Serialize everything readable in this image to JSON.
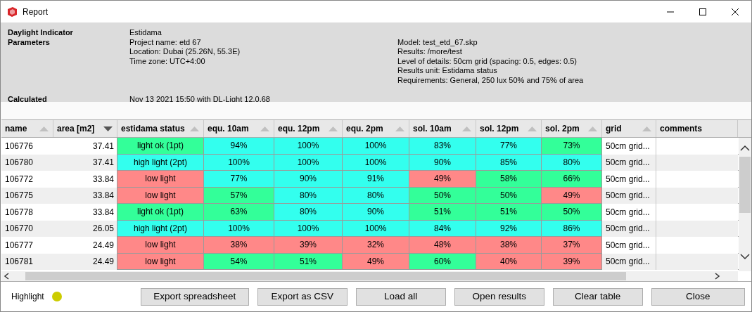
{
  "window": {
    "title": "Report"
  },
  "info": {
    "indicator": {
      "label": "Daylight Indicator",
      "value": "Estidama"
    },
    "parameters": {
      "label": "Parameters",
      "left": [
        "Project name: etd 67",
        "Location: Dubai (25.26N, 55.3E)",
        "Time zone: UTC+4:00"
      ],
      "right": [
        "Model: test_etd_67.skp",
        "Results: /more/test",
        "Level of details: 50cm grid (spacing: 0.5, edges: 0.5)",
        "Results unit: Estidama status",
        "Requirements: General, 250 lux 50% and 75% of area"
      ]
    },
    "calculated": {
      "label": "Calculated",
      "value": "Nov 13 2021 15:50 with DL-Light 12.0.68"
    }
  },
  "table": {
    "columns": [
      {
        "label": "name",
        "sortable": true,
        "descending": false
      },
      {
        "label": "area [m2]",
        "sortable": true,
        "descending": true
      },
      {
        "label": "estidama status",
        "sortable": true,
        "descending": false
      },
      {
        "label": "equ. 10am",
        "sortable": true,
        "descending": false
      },
      {
        "label": "equ. 12pm",
        "sortable": true,
        "descending": false
      },
      {
        "label": "equ. 2pm",
        "sortable": true,
        "descending": false
      },
      {
        "label": "sol. 10am",
        "sortable": true,
        "descending": false
      },
      {
        "label": "sol. 12pm",
        "sortable": true,
        "descending": false
      },
      {
        "label": "sol. 2pm",
        "sortable": true,
        "descending": false
      },
      {
        "label": "grid",
        "sortable": true,
        "descending": false
      },
      {
        "label": "comments",
        "sortable": false
      }
    ],
    "rows": [
      {
        "name": "106776",
        "area": "37.41",
        "status": {
          "text": "light ok (1pt)",
          "color": "#33ff99"
        },
        "values": [
          {
            "text": "94%",
            "color": "#33ffee"
          },
          {
            "text": "100%",
            "color": "#33ffee"
          },
          {
            "text": "100%",
            "color": "#33ffee"
          },
          {
            "text": "83%",
            "color": "#33ffee"
          },
          {
            "text": "77%",
            "color": "#33ffee"
          },
          {
            "text": "73%",
            "color": "#33ff99"
          }
        ],
        "grid": "50cm grid..."
      },
      {
        "name": "106780",
        "area": "37.41",
        "status": {
          "text": "high light (2pt)",
          "color": "#33ffee"
        },
        "values": [
          {
            "text": "100%",
            "color": "#33ffee"
          },
          {
            "text": "100%",
            "color": "#33ffee"
          },
          {
            "text": "100%",
            "color": "#33ffee"
          },
          {
            "text": "90%",
            "color": "#33ffee"
          },
          {
            "text": "85%",
            "color": "#33ffee"
          },
          {
            "text": "80%",
            "color": "#33ffee"
          }
        ],
        "grid": "50cm grid..."
      },
      {
        "name": "106772",
        "area": "33.84",
        "status": {
          "text": "low light",
          "color": "#ff8888"
        },
        "values": [
          {
            "text": "77%",
            "color": "#33ffee"
          },
          {
            "text": "90%",
            "color": "#33ffee"
          },
          {
            "text": "91%",
            "color": "#33ffee"
          },
          {
            "text": "49%",
            "color": "#ff8888"
          },
          {
            "text": "58%",
            "color": "#33ff99"
          },
          {
            "text": "66%",
            "color": "#33ff99"
          }
        ],
        "grid": "50cm grid..."
      },
      {
        "name": "106775",
        "area": "33.84",
        "status": {
          "text": "low light",
          "color": "#ff8888"
        },
        "values": [
          {
            "text": "57%",
            "color": "#33ff99"
          },
          {
            "text": "80%",
            "color": "#33ffee"
          },
          {
            "text": "80%",
            "color": "#33ffee"
          },
          {
            "text": "50%",
            "color": "#33ff99"
          },
          {
            "text": "50%",
            "color": "#33ff99"
          },
          {
            "text": "49%",
            "color": "#ff8888"
          }
        ],
        "grid": "50cm grid..."
      },
      {
        "name": "106778",
        "area": "33.84",
        "status": {
          "text": "light ok (1pt)",
          "color": "#33ff99"
        },
        "values": [
          {
            "text": "63%",
            "color": "#33ff99"
          },
          {
            "text": "80%",
            "color": "#33ffee"
          },
          {
            "text": "90%",
            "color": "#33ffee"
          },
          {
            "text": "51%",
            "color": "#33ff99"
          },
          {
            "text": "51%",
            "color": "#33ff99"
          },
          {
            "text": "50%",
            "color": "#33ff99"
          }
        ],
        "grid": "50cm grid..."
      },
      {
        "name": "106770",
        "area": "26.05",
        "status": {
          "text": "high light (2pt)",
          "color": "#33ffee"
        },
        "values": [
          {
            "text": "100%",
            "color": "#33ffee"
          },
          {
            "text": "100%",
            "color": "#33ffee"
          },
          {
            "text": "100%",
            "color": "#33ffee"
          },
          {
            "text": "84%",
            "color": "#33ffee"
          },
          {
            "text": "92%",
            "color": "#33ffee"
          },
          {
            "text": "86%",
            "color": "#33ffee"
          }
        ],
        "grid": "50cm grid..."
      },
      {
        "name": "106777",
        "area": "24.49",
        "status": {
          "text": "low light",
          "color": "#ff8888"
        },
        "values": [
          {
            "text": "38%",
            "color": "#ff8888"
          },
          {
            "text": "39%",
            "color": "#ff8888"
          },
          {
            "text": "32%",
            "color": "#ff8888"
          },
          {
            "text": "48%",
            "color": "#ff8888"
          },
          {
            "text": "38%",
            "color": "#ff8888"
          },
          {
            "text": "37%",
            "color": "#ff8888"
          }
        ],
        "grid": "50cm grid..."
      },
      {
        "name": "106781",
        "area": "24.49",
        "status": {
          "text": "low light",
          "color": "#ff8888"
        },
        "values": [
          {
            "text": "54%",
            "color": "#33ff99"
          },
          {
            "text": "51%",
            "color": "#33ff99"
          },
          {
            "text": "49%",
            "color": "#ff8888"
          },
          {
            "text": "60%",
            "color": "#33ff99"
          },
          {
            "text": "40%",
            "color": "#ff8888"
          },
          {
            "text": "39%",
            "color": "#ff8888"
          }
        ],
        "grid": "50cm grid..."
      }
    ]
  },
  "highlight": {
    "label": "Highlight",
    "color": "#cccc00"
  },
  "buttons": [
    "Export spreadsheet",
    "Export as CSV",
    "Load all",
    "Open results",
    "Clear table",
    "Close"
  ]
}
